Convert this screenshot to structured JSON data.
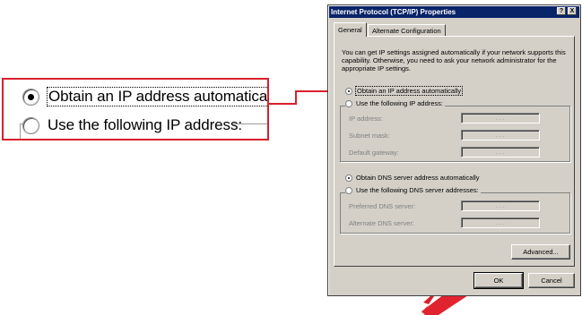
{
  "dialog": {
    "title": "Internet Protocol (TCP/IP) Properties",
    "help_button": "?",
    "close_button": "X",
    "tabs": [
      {
        "label": "General",
        "active": true
      },
      {
        "label": "Alternate Configuration",
        "active": false
      }
    ],
    "description": "You can get IP settings assigned automatically if your network supports this capability. Otherwise, you need to ask your network administrator for the appropriate IP settings.",
    "ip_options": {
      "auto": {
        "label": "Obtain an IP address automatically",
        "checked": true
      },
      "manual": {
        "label": "Use the following IP address:",
        "checked": false
      }
    },
    "ip_fields": [
      {
        "label": "IP address:",
        "value": ". . ."
      },
      {
        "label": "Subnet mask:",
        "value": ". . ."
      },
      {
        "label": "Default gateway:",
        "value": ". . ."
      }
    ],
    "dns_options": {
      "auto": {
        "label": "Obtain DNS server address automatically",
        "checked": true
      },
      "manual": {
        "label": "Use the following DNS server addresses:",
        "checked": false
      }
    },
    "dns_fields": [
      {
        "label": "Preferred DNS server:",
        "value": ". . ."
      },
      {
        "label": "Alternate DNS server:",
        "value": ". . ."
      }
    ],
    "advanced_button": "Advanced...",
    "ok_button": "OK",
    "cancel_button": "Cancel"
  },
  "zoom": {
    "auto_label": "Obtain an IP address automatically",
    "manual_label": "Use the following IP address:"
  },
  "colors": {
    "callout_red": "#d9202c",
    "dialog_face": "#d4d0c8",
    "titlebar": "#0a246a"
  }
}
